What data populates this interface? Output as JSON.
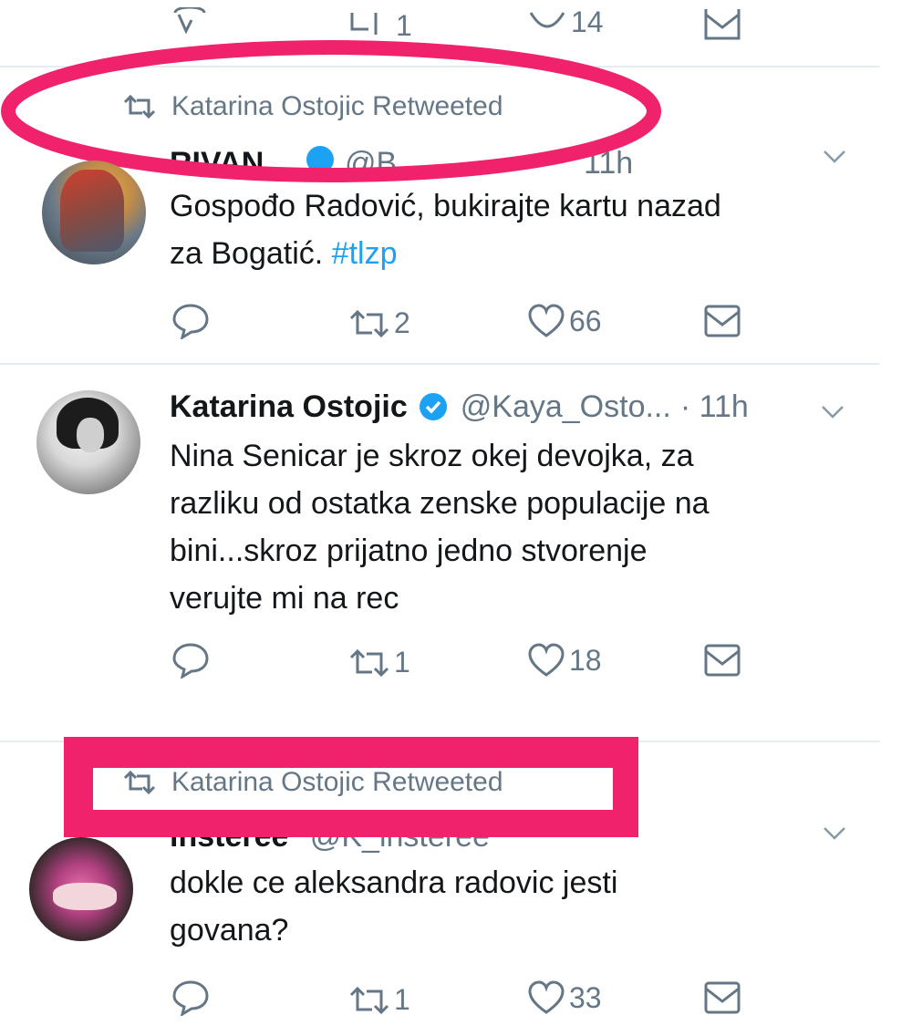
{
  "tweets": [
    {
      "actions": {
        "reply": "",
        "retweet": "1",
        "like": "14"
      }
    },
    {
      "retweeted_by": "Katarina Ostojic Retweeted",
      "author_fragment": "RIVAN",
      "handle_fragment": "@B",
      "time_fragment": "11h",
      "text_line1": "Gospođo Radović, bukirajte kartu nazad",
      "text_line2": "za Bogatić.",
      "hashtag": "#tlzp",
      "actions": {
        "retweet": "2",
        "like": "66"
      }
    },
    {
      "author": "Katarina Ostojic",
      "handle": "@Kaya_Osto...",
      "time": "· 11h",
      "text_lines": [
        "Nina Senicar je skroz okej devojka, za",
        "razliku od ostatka zenske populacije na",
        "bini...skroz prijatno jedno stvorenje",
        "verujte mi na rec"
      ],
      "actions": {
        "retweet": "1",
        "like": "18"
      }
    },
    {
      "retweeted_by": "Katarina Ostojic Retweeted",
      "author_fragment": "insteree",
      "handle_fragment": "@K_insteree",
      "text_lines": [
        "dokle ce aleksandra radovic jesti",
        "govana?"
      ],
      "actions": {
        "retweet": "1",
        "like": "33"
      }
    }
  ],
  "colors": {
    "highlight": "#f0226b",
    "verified": "#1da1f2",
    "hashtag": "#1da1f2",
    "muted": "#657786"
  },
  "icons": [
    "reply-icon",
    "retweet-icon",
    "like-icon",
    "dm-icon",
    "chevron-down-icon",
    "verified-badge-icon"
  ]
}
